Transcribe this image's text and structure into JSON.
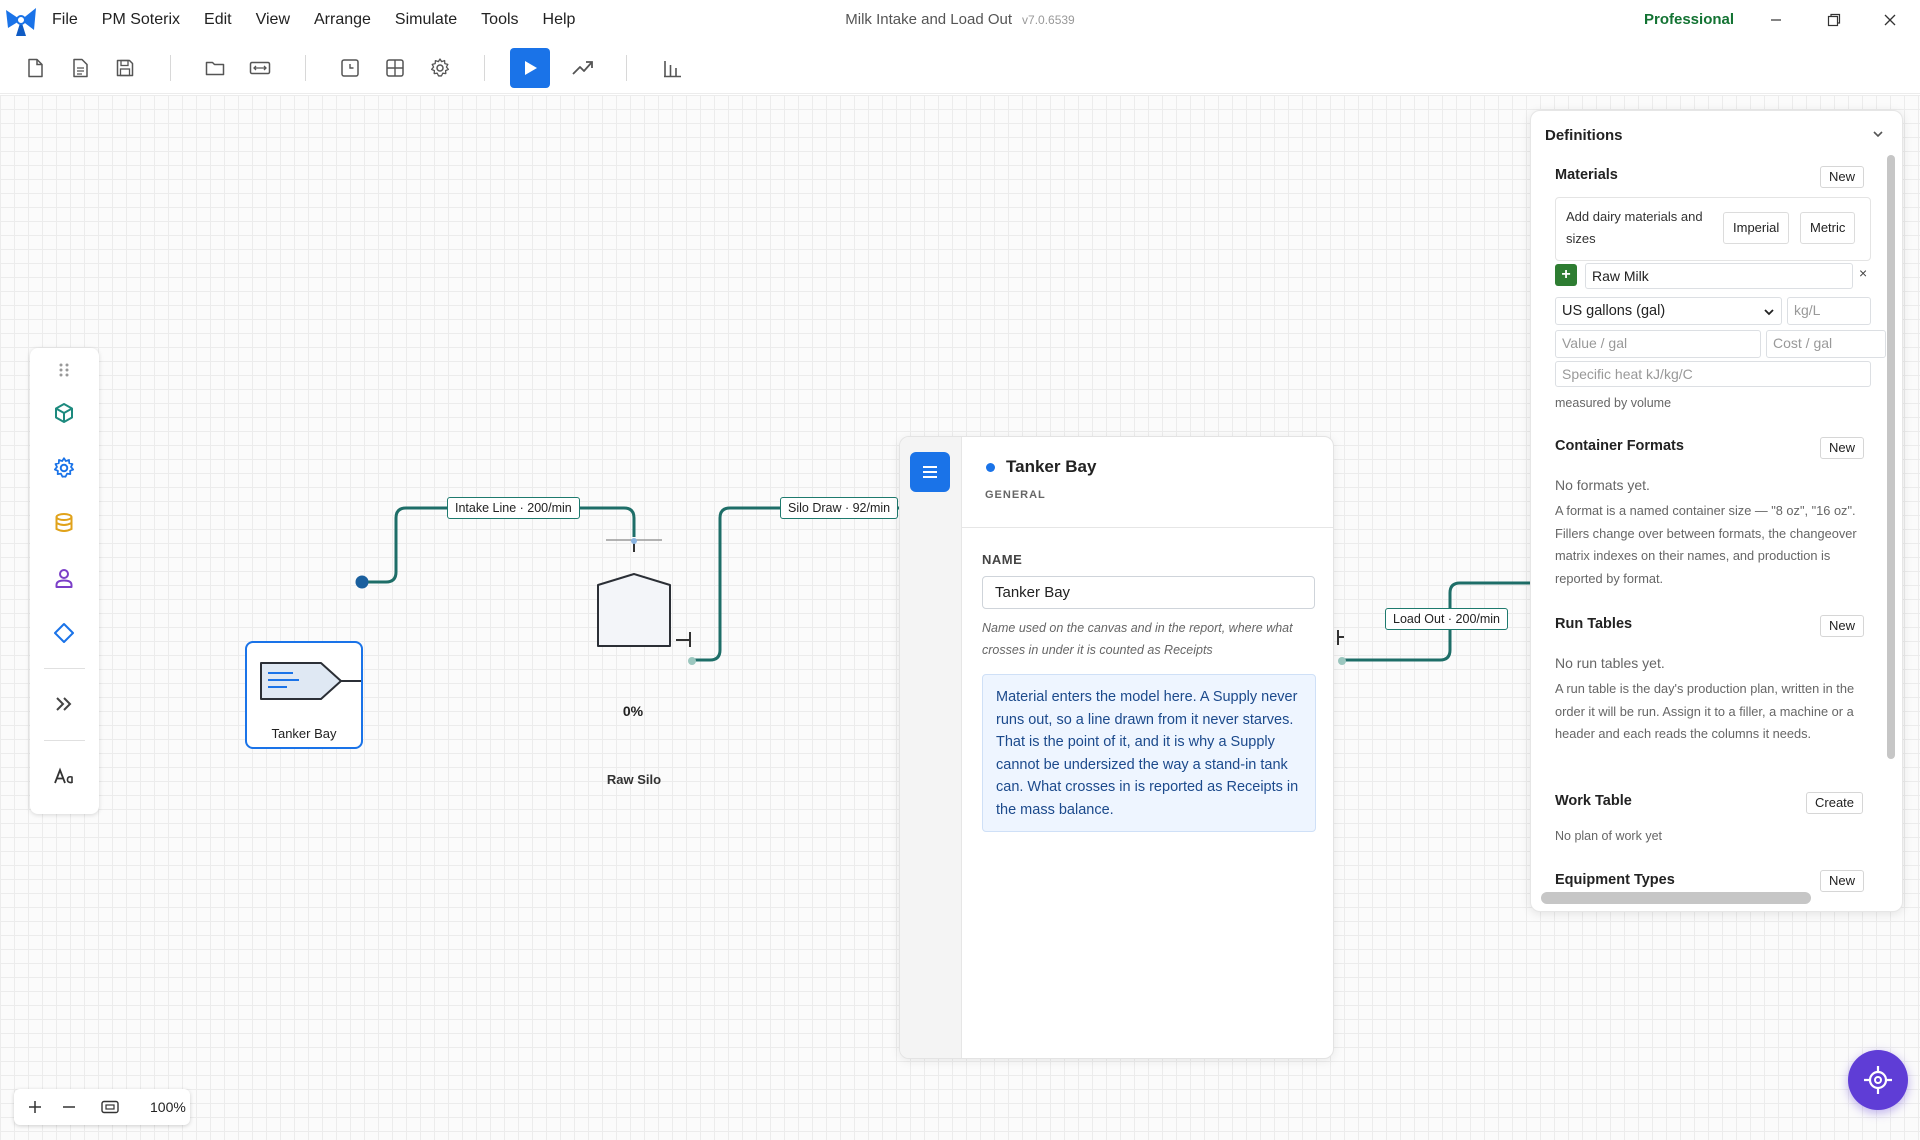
{
  "window": {
    "title": "Milk Intake and Load Out",
    "version": "v7.0.6539",
    "edition": "Professional"
  },
  "menu": [
    "File",
    "PM Soterix",
    "Edit",
    "View",
    "Arrange",
    "Simulate",
    "Tools",
    "Help"
  ],
  "toolbar": {
    "icons": [
      "new-file-icon",
      "document-icon",
      "save-icon",
      "open-folder-icon",
      "fit-width-icon",
      "clock-icon",
      "grid-icon",
      "settings-icon",
      "run-icon",
      "trend-icon",
      "bar-chart-icon"
    ]
  },
  "canvas": {
    "nodes": {
      "supply": {
        "label": "Tanker Bay"
      },
      "silo": {
        "label": "Raw Silo",
        "fill": "0%"
      }
    },
    "edges": [
      {
        "label": "Intake Line · 200/min"
      },
      {
        "label": "Silo Draw · 92/min"
      },
      {
        "label": "Load Out · 200/min"
      }
    ],
    "zoom": "100%"
  },
  "palette": {
    "icons": [
      "material-cube-icon",
      "machine-gear-icon",
      "tank-database-icon",
      "operator-person-icon",
      "decision-diamond-icon",
      "expand-chevrons-icon",
      "text-style-icon"
    ]
  },
  "properties": {
    "title": "Tanker Bay",
    "subtitle": "GENERAL",
    "name_label": "NAME",
    "name_value": "Tanker Bay",
    "name_hint": "Name used on the canvas and in the report, where what crosses in under it is counted as Receipts",
    "note": "Material enters the model here. A Supply never runs out, so a line drawn from it never starves. That is the point of it, and it is why a Supply cannot be undersized the way a stand-in tank can. What crosses in is reported as Receipts in the mass balance."
  },
  "definitions": {
    "title": "Definitions",
    "materials": {
      "title": "Materials",
      "new_label": "New",
      "intro": "Add dairy materials and sizes",
      "imperial_label": "Imperial",
      "metric_label": "Metric",
      "material_name": "Raw Milk",
      "remove_label": "×",
      "unit_selected": "US gallons (gal)",
      "density_placeholder": "kg/L",
      "value_placeholder": "Value / gal",
      "cost_placeholder": "Cost / gal",
      "specific_heat_placeholder": "Specific heat kJ/kg/C",
      "measure_note": "measured by volume"
    },
    "container_formats": {
      "title": "Container Formats",
      "new_label": "New",
      "empty": "No formats yet.",
      "description": "A format is a named container size — \"8 oz\", \"16 oz\". Fillers change over between formats, the changeover matrix indexes on their names, and production is reported by format."
    },
    "run_tables": {
      "title": "Run Tables",
      "new_label": "New",
      "empty": "No run tables yet.",
      "description": "A run table is the day's production plan, written in the order it will be run. Assign it to a filler, a machine or a header and each reads the columns it needs."
    },
    "work_table": {
      "title": "Work Table",
      "create_label": "Create",
      "empty": "No plan of work yet"
    },
    "equipment_types": {
      "title": "Equipment Types",
      "new_label": "New"
    }
  },
  "colors": {
    "accent": "#1a73e8",
    "edge": "#1e7a6e",
    "edition": "#137333",
    "fab": "#5f3dd6"
  }
}
